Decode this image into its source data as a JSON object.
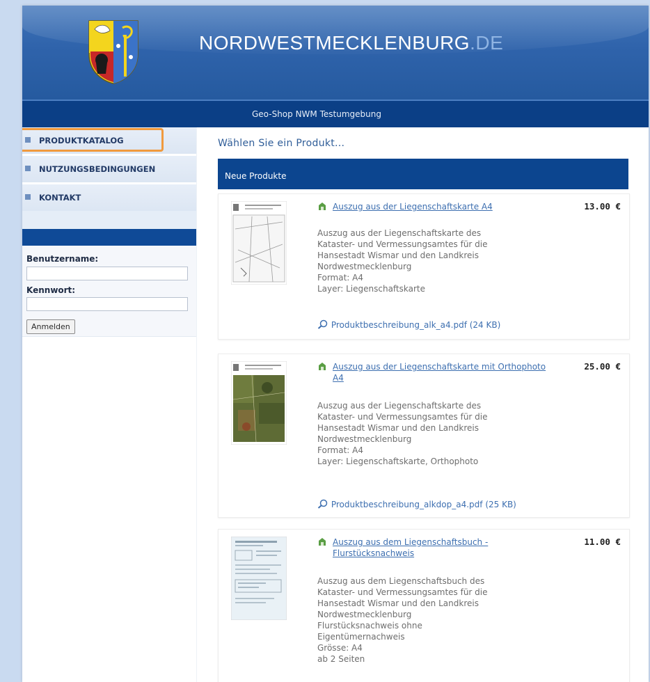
{
  "header": {
    "site_name": "NORDWESTMECKLENBURG",
    "site_tld": ".DE",
    "subtitle": "Geo-Shop NWM Testumgebung"
  },
  "sidebar": {
    "nav": [
      {
        "label": "PRODUKTKATALOG",
        "active": true
      },
      {
        "label": "NUTZUNGSBEDINGUNGEN",
        "active": false
      },
      {
        "label": "KONTAKT",
        "active": false
      }
    ],
    "login": {
      "username_label": "Benutzername:",
      "username_value": "",
      "password_label": "Kennwort:",
      "password_value": "",
      "button_label": "Anmelden"
    }
  },
  "main": {
    "heading": "Wählen Sie ein Produkt...",
    "section_title": "Neue Produkte",
    "products": [
      {
        "name": "Auszug aus der Liegenschaftskarte A4",
        "price": "13.00 €",
        "description": "Auszug aus der Liegenschaftskarte des\nKataster- und Vermessungsamtes für die\nHansestadt Wismar und den Landkreis\nNordwestmecklenburg\nFormat: A4\nLayer: Liegenschaftskarte",
        "pdf": "Produktbeschreibung_alk_a4.pdf (24 KB)"
      },
      {
        "name": "Auszug aus der Liegenschaftskarte mit Orthophoto A4",
        "price": "25.00 €",
        "description": "Auszug aus der Liegenschaftskarte des\nKataster- und Vermessungsamtes für die\nHansestadt Wismar und den Landkreis\nNordwestmecklenburg\nFormat: A4\nLayer: Liegenschaftskarte, Orthophoto",
        "pdf": "Produktbeschreibung_alkdop_a4.pdf (25 KB)"
      },
      {
        "name": "Auszug aus dem Liegenschaftsbuch - Flurstücksnachweis",
        "price": "11.00 €",
        "description": "Auszug aus dem Liegenschaftsbuch des\nKataster- und Vermessungsamtes für die\nHansestadt Wismar und den Landkreis\nNordwestmecklenburg\nFlurstücksnachweis ohne\nEigentümernachweis\nGrösse: A4\nab 2 Seiten",
        "pdf": ""
      }
    ]
  },
  "colors": {
    "banner": "#2f63ab",
    "subbar": "#0b3f86",
    "section_header": "#0c458f",
    "link": "#3d6fb0",
    "nav_highlight": "#f09a3e",
    "background": "#c9daf0"
  },
  "icons": [
    "coat-of-arms-icon",
    "nav-bullet-icon",
    "product-icon",
    "magnifier-icon"
  ]
}
